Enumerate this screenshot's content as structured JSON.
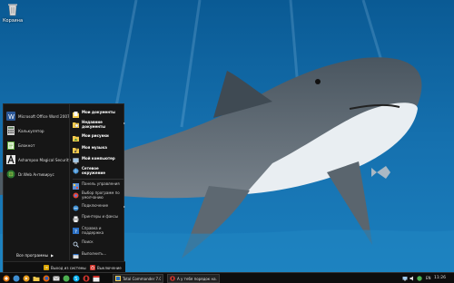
{
  "desktop": {
    "icons": [
      {
        "label": "Корзина",
        "icon": "recycle-bin-icon"
      }
    ]
  },
  "start_menu": {
    "pinned": [
      {
        "label": "Microsoft Office Word 2007",
        "icon": "word-icon",
        "color": "#2b5797"
      },
      {
        "label": "Калькулятор",
        "icon": "calculator-icon",
        "color": "#cfcfcf"
      },
      {
        "label": "Блокнот",
        "icon": "notepad-icon",
        "color": "#5ca53a"
      },
      {
        "label": "Ashampoo Magical Security",
        "icon": "magic-icon",
        "color": "#e8e8e8"
      },
      {
        "label": "Dr.Web Антивирус",
        "icon": "drweb-icon",
        "color": "#4caf50"
      }
    ],
    "all_programs": "Все программы",
    "right": [
      {
        "label": "Мои документы",
        "icon": "documents-icon",
        "bold": true
      },
      {
        "label": "Недавние документы",
        "icon": "recent-documents-icon",
        "bold": true,
        "submenu": true
      },
      {
        "label": "Мои рисунки",
        "icon": "pictures-icon",
        "bold": true
      },
      {
        "label": "Моя музыка",
        "icon": "music-icon",
        "bold": true
      },
      {
        "label": "Мой компьютер",
        "icon": "computer-icon",
        "bold": true
      },
      {
        "label": "Сетевое окружение",
        "icon": "network-icon",
        "bold": true
      },
      {
        "label": "Панель управления",
        "icon": "control-panel-icon",
        "bold": false
      },
      {
        "label": "Выбор программ по умолчанию",
        "icon": "default-programs-icon",
        "bold": false
      },
      {
        "label": "Подключение",
        "icon": "connect-icon",
        "bold": false,
        "submenu": true
      },
      {
        "label": "Принтеры и факсы",
        "icon": "printer-icon",
        "bold": false
      },
      {
        "label": "Справка и поддержка",
        "icon": "help-icon",
        "bold": false
      },
      {
        "label": "Поиск",
        "icon": "search-icon",
        "bold": false
      },
      {
        "label": "Выполнить...",
        "icon": "run-icon",
        "bold": false
      }
    ],
    "logoff_label": "Выход из системы",
    "shutdown_label": "Выключение"
  },
  "taskbar": {
    "windows": [
      {
        "label": "Total Commander 7.0...",
        "icon": "total-commander-icon"
      },
      {
        "label": "А у тебя порядок на...",
        "icon": "opera-icon"
      }
    ],
    "language": "EN",
    "clock": "11:26"
  },
  "colors": {
    "water_top": "#0b5f98",
    "water_bottom": "#1c78b3",
    "menu_bg": "#161616",
    "taskbar_bg": "#0d0d0d"
  }
}
